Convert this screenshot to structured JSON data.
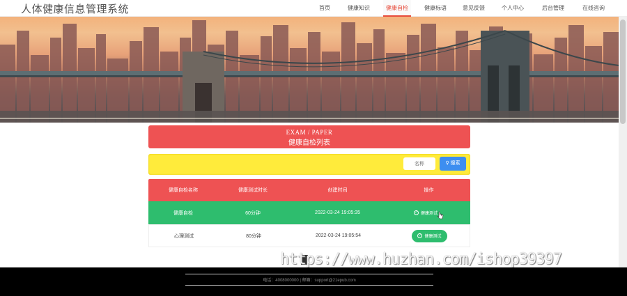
{
  "app": {
    "title": "人体健康信息管理系统"
  },
  "nav": {
    "items": [
      {
        "label": "首页"
      },
      {
        "label": "健康知识"
      },
      {
        "label": "健康自检"
      },
      {
        "label": "健康标语"
      },
      {
        "label": "意见反馈"
      },
      {
        "label": "个人中心"
      },
      {
        "label": "后台管理"
      },
      {
        "label": "在线咨询"
      }
    ],
    "active_index": 2
  },
  "heading": {
    "en": "EXAM / PAPER",
    "zh": "健康自检列表"
  },
  "search": {
    "placeholder": "名称",
    "button_label": "搜索"
  },
  "table": {
    "headers": [
      "健康自检名称",
      "健康测试时长",
      "创建时间",
      "操作"
    ],
    "rows": [
      {
        "name": "健康自检",
        "duration": "60分钟",
        "created": "2022-03-24 19:05:35",
        "action": "健康测试"
      },
      {
        "name": "心理测试",
        "duration": "80分钟",
        "created": "2022-03-24 19:05:54",
        "action": "健康测试"
      }
    ]
  },
  "watermark": "https://www.huzhan.com/ishop39397",
  "footer": {
    "contact": "电话：4008000000 | 邮箱：support@21epub.com"
  },
  "colors": {
    "accent_red": "#ee5253",
    "accent_green": "#2ebd6e",
    "search_bg": "#ffeb3b",
    "button_blue": "#3d8ef0"
  },
  "icons": [
    "search-icon",
    "check-circle-icon",
    "cursor-icon"
  ]
}
